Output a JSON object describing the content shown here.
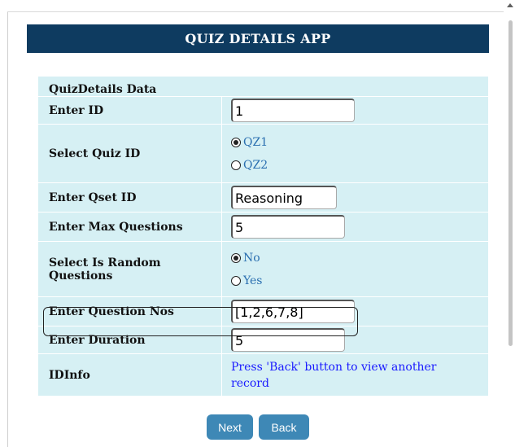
{
  "app": {
    "title": "QUIZ DETAILS APP"
  },
  "form": {
    "section_title": "QuizDetails Data",
    "id": {
      "label": "Enter ID",
      "value": "1"
    },
    "quiz_id": {
      "label": "Select Quiz ID",
      "options": [
        {
          "label": "QZ1",
          "checked": true
        },
        {
          "label": "QZ2",
          "checked": false
        }
      ]
    },
    "qset_id": {
      "label": "Enter Qset ID",
      "value": "Reasoning"
    },
    "max_questions": {
      "label": "Enter Max Questions",
      "value": "5"
    },
    "is_random": {
      "label": "Select Is Random Questions",
      "options": [
        {
          "label": "No",
          "checked": true
        },
        {
          "label": "Yes",
          "checked": false
        }
      ]
    },
    "question_nos": {
      "label": "Enter Question Nos",
      "value": "[1,2,6,7,8]"
    },
    "duration": {
      "label": "Enter Duration",
      "value": "5"
    },
    "id_info": {
      "label": "IDInfo",
      "text": "Press 'Back' button to view another record"
    }
  },
  "buttons": {
    "next": "Next",
    "back": "Back"
  },
  "colors": {
    "header_bg": "#0e3b60",
    "table_bg": "#d6f0f4",
    "button_bg": "#3e88b6",
    "radio_label": "#2a6fb0",
    "info_text": "#1a1aff"
  }
}
